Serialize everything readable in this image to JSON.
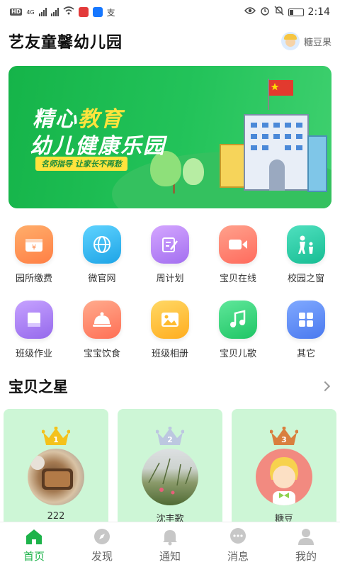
{
  "status_bar": {
    "time": "2:14",
    "network": "4G",
    "hd": "HD"
  },
  "header": {
    "app_title": "艺友童馨幼儿园",
    "user_name": "糖豆果"
  },
  "banner": {
    "line1_a": "精心",
    "line1_b": "教育",
    "line2": "幼儿健康乐园",
    "tag": "名师指导 让家长不再愁"
  },
  "features": [
    {
      "label": "园所缴费",
      "icon": "yen-wallet-icon",
      "color": "#ff8a4c"
    },
    {
      "label": "微官网",
      "icon": "globe-icon",
      "color": "#2bb6f0"
    },
    {
      "label": "周计划",
      "icon": "edit-document-icon",
      "color": "#b57bf0"
    },
    {
      "label": "宝贝在线",
      "icon": "video-camera-icon",
      "color": "#ff7a6b"
    },
    {
      "label": "校园之窗",
      "icon": "parent-child-icon",
      "color": "#21c9a2"
    },
    {
      "label": "班级作业",
      "icon": "book-icon",
      "color": "#a679ef"
    },
    {
      "label": "宝宝饮食",
      "icon": "food-cloche-icon",
      "color": "#ff7e62"
    },
    {
      "label": "班级相册",
      "icon": "photo-album-icon",
      "color": "#ffbb2e"
    },
    {
      "label": "宝贝儿歌",
      "icon": "music-note-icon",
      "color": "#2fd27a"
    },
    {
      "label": "其它",
      "icon": "grid-apps-icon",
      "color": "#5b8cf5"
    }
  ],
  "stars_section": {
    "title": "宝贝之星"
  },
  "stars": [
    {
      "rank": "1",
      "name": "222",
      "crown_color": "#f4c21b"
    },
    {
      "rank": "2",
      "name": "沈丰歌",
      "crown_color": "#bcc7e0"
    },
    {
      "rank": "3",
      "name": "糖豆",
      "crown_color": "#d97f3e"
    }
  ],
  "tabs": [
    {
      "label": "首页",
      "icon": "home-icon",
      "active": true
    },
    {
      "label": "发现",
      "icon": "compass-icon",
      "active": false
    },
    {
      "label": "通知",
      "icon": "bell-icon",
      "active": false
    },
    {
      "label": "消息",
      "icon": "chat-bubble-icon",
      "active": false
    },
    {
      "label": "我的",
      "icon": "person-icon",
      "active": false
    }
  ],
  "colors": {
    "accent": "#1db34a",
    "card_bg": "#cdf6d6"
  }
}
